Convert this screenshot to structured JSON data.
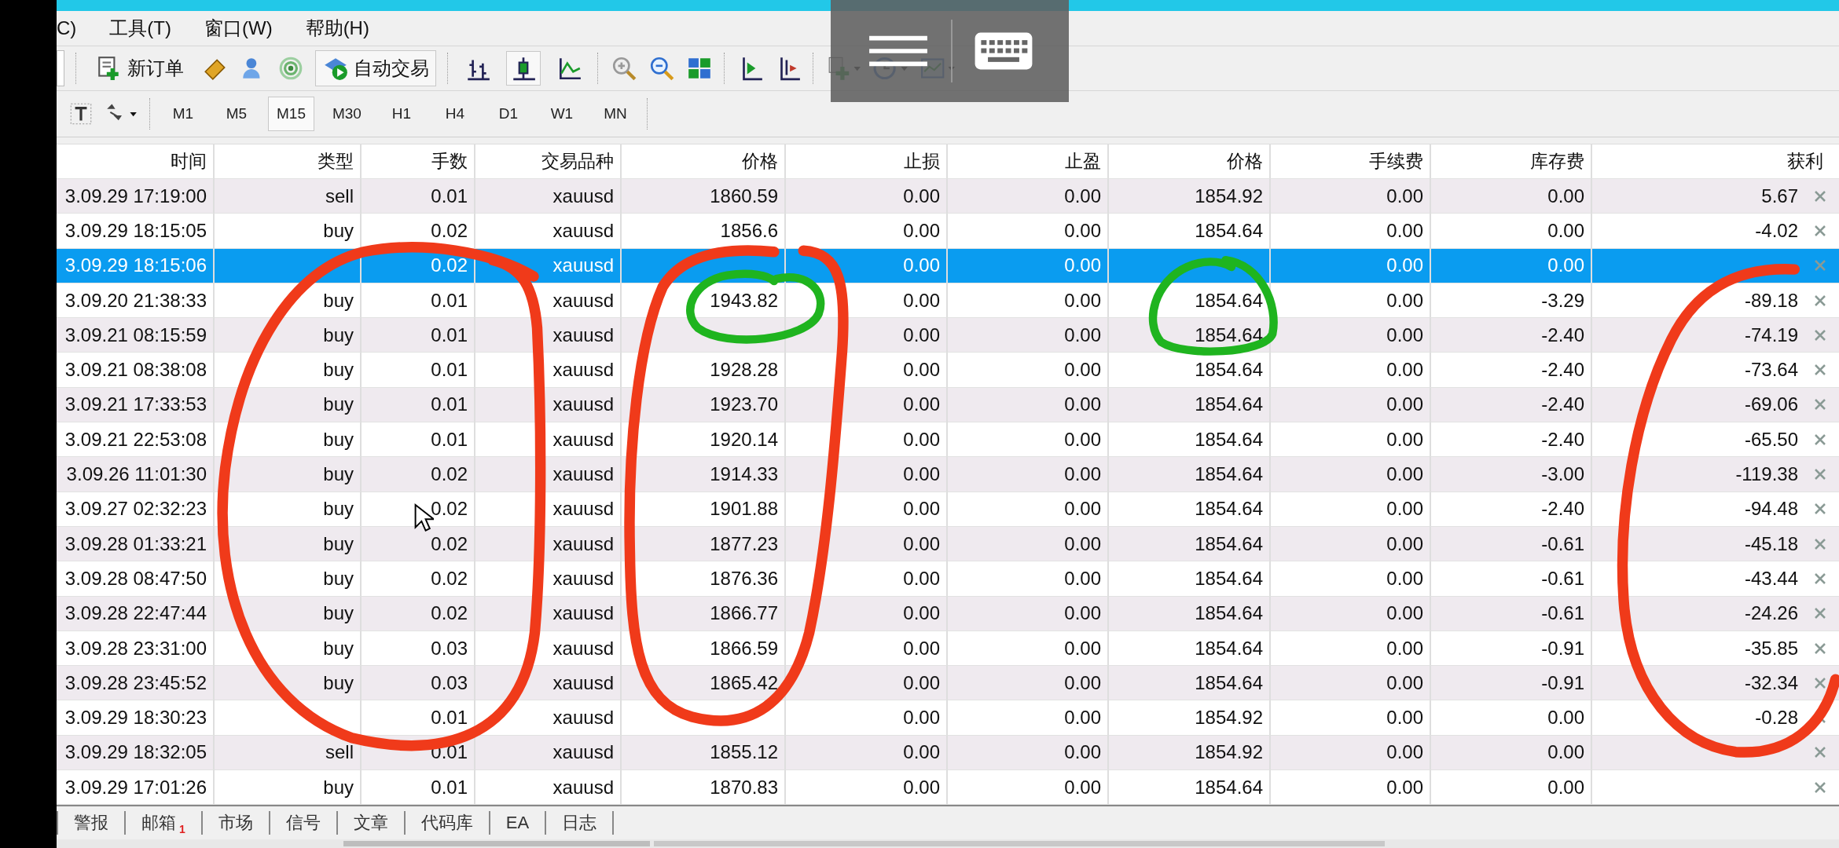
{
  "menu": [
    {
      "label": "C)"
    },
    {
      "label": "工具(T)"
    },
    {
      "label": "窗口(W)"
    },
    {
      "label": "帮助(H)"
    }
  ],
  "toolbar": {
    "new_order": "新订单",
    "autotrading": {
      "label": "自动交易",
      "on": true
    },
    "chart_types": [
      {
        "kind": "bar",
        "selected": false
      },
      {
        "kind": "candle",
        "selected": true
      },
      {
        "kind": "line",
        "selected": false
      }
    ]
  },
  "periods": [
    {
      "label": "M1",
      "selected": false
    },
    {
      "label": "M5",
      "selected": false
    },
    {
      "label": "M15",
      "selected": true
    },
    {
      "label": "M30",
      "selected": false
    },
    {
      "label": "H1",
      "selected": false
    },
    {
      "label": "H4",
      "selected": false
    },
    {
      "label": "D1",
      "selected": false
    },
    {
      "label": "W1",
      "selected": false
    },
    {
      "label": "MN",
      "selected": false
    }
  ],
  "table": {
    "columns": [
      "时间",
      "类型",
      "手数",
      "交易品种",
      "价格",
      "止损",
      "止盈",
      "价格",
      "手续费",
      "库存费",
      "获利"
    ],
    "rows": [
      {
        "selected": false,
        "cells": [
          "3.09.29 17:19:00",
          "sell",
          "0.01",
          "xauusd",
          "1860.59",
          "0.00",
          "0.00",
          "1854.92",
          "0.00",
          "0.00",
          "5.67"
        ]
      },
      {
        "selected": false,
        "cells": [
          "3.09.29 18:15:05",
          "buy",
          "0.02",
          "xauusd",
          "1856.6",
          "0.00",
          "0.00",
          "1854.64",
          "0.00",
          "0.00",
          "-4.02"
        ]
      },
      {
        "selected": true,
        "cells": [
          "3.09.29 18:15:06",
          null,
          "0.02",
          "xauusd",
          null,
          "0.00",
          "0.00",
          null,
          "0.00",
          "0.00",
          null
        ]
      },
      {
        "selected": false,
        "cells": [
          "3.09.20 21:38:33",
          "buy",
          "0.01",
          "xauusd",
          "1943.82",
          "0.00",
          "0.00",
          "1854.64",
          "0.00",
          "-3.29",
          "-89.18"
        ]
      },
      {
        "selected": false,
        "cells": [
          "3.09.21 08:15:59",
          "buy",
          "0.01",
          "xauusd",
          null,
          "0.00",
          "0.00",
          "1854.64",
          "0.00",
          "-2.40",
          "-74.19"
        ]
      },
      {
        "selected": false,
        "cells": [
          "3.09.21 08:38:08",
          "buy",
          "0.01",
          "xauusd",
          "1928.28",
          "0.00",
          "0.00",
          "1854.64",
          "0.00",
          "-2.40",
          "-73.64"
        ]
      },
      {
        "selected": false,
        "cells": [
          "3.09.21 17:33:53",
          "buy",
          "0.01",
          "xauusd",
          "1923.70",
          "0.00",
          "0.00",
          "1854.64",
          "0.00",
          "-2.40",
          "-69.06"
        ]
      },
      {
        "selected": false,
        "cells": [
          "3.09.21 22:53:08",
          "buy",
          "0.01",
          "xauusd",
          "1920.14",
          "0.00",
          "0.00",
          "1854.64",
          "0.00",
          "-2.40",
          "-65.50"
        ]
      },
      {
        "selected": false,
        "cells": [
          "3.09.26 11:01:30",
          "buy",
          "0.02",
          "xauusd",
          "1914.33",
          "0.00",
          "0.00",
          "1854.64",
          "0.00",
          "-3.00",
          "-119.38"
        ]
      },
      {
        "selected": false,
        "cells": [
          "3.09.27 02:32:23",
          "buy",
          "0.02",
          "xauusd",
          "1901.88",
          "0.00",
          "0.00",
          "1854.64",
          "0.00",
          "-2.40",
          "-94.48"
        ]
      },
      {
        "selected": false,
        "cells": [
          "3.09.28 01:33:21",
          "buy",
          "0.02",
          "xauusd",
          "1877.23",
          "0.00",
          "0.00",
          "1854.64",
          "0.00",
          "-0.61",
          "-45.18"
        ]
      },
      {
        "selected": false,
        "cells": [
          "3.09.28 08:47:50",
          "buy",
          "0.02",
          "xauusd",
          "1876.36",
          "0.00",
          "0.00",
          "1854.64",
          "0.00",
          "-0.61",
          "-43.44"
        ]
      },
      {
        "selected": false,
        "cells": [
          "3.09.28 22:47:44",
          "buy",
          "0.02",
          "xauusd",
          "1866.77",
          "0.00",
          "0.00",
          "1854.64",
          "0.00",
          "-0.61",
          "-24.26"
        ]
      },
      {
        "selected": false,
        "cells": [
          "3.09.28 23:31:00",
          "buy",
          "0.03",
          "xauusd",
          "1866.59",
          "0.00",
          "0.00",
          "1854.64",
          "0.00",
          "-0.91",
          "-35.85"
        ]
      },
      {
        "selected": false,
        "cells": [
          "3.09.28 23:45:52",
          "buy",
          "0.03",
          "xauusd",
          "1865.42",
          "0.00",
          "0.00",
          "1854.64",
          "0.00",
          "-0.91",
          "-32.34"
        ]
      },
      {
        "selected": false,
        "cells": [
          "3.09.29 18:30:23",
          null,
          "0.01",
          "xauusd",
          null,
          "0.00",
          "0.00",
          "1854.92",
          "0.00",
          "0.00",
          "-0.28"
        ]
      },
      {
        "selected": false,
        "cells": [
          "3.09.29 18:32:05",
          "sell",
          "0.01",
          "xauusd",
          "1855.12",
          "0.00",
          "0.00",
          "1854.92",
          "0.00",
          "0.00",
          null
        ]
      },
      {
        "selected": false,
        "cells": [
          "3.09.29 17:01:26",
          "buy",
          "0.01",
          "xauusd",
          "1870.83",
          "0.00",
          "0.00",
          "1854.64",
          "0.00",
          "0.00",
          null
        ]
      }
    ]
  },
  "bottom_tabs": [
    {
      "label": "警报"
    },
    {
      "label": "邮箱",
      "badge": "1"
    },
    {
      "label": "市场"
    },
    {
      "label": "信号"
    },
    {
      "label": "文章"
    },
    {
      "label": "代码库"
    },
    {
      "label": "EA"
    },
    {
      "label": "日志"
    }
  ]
}
